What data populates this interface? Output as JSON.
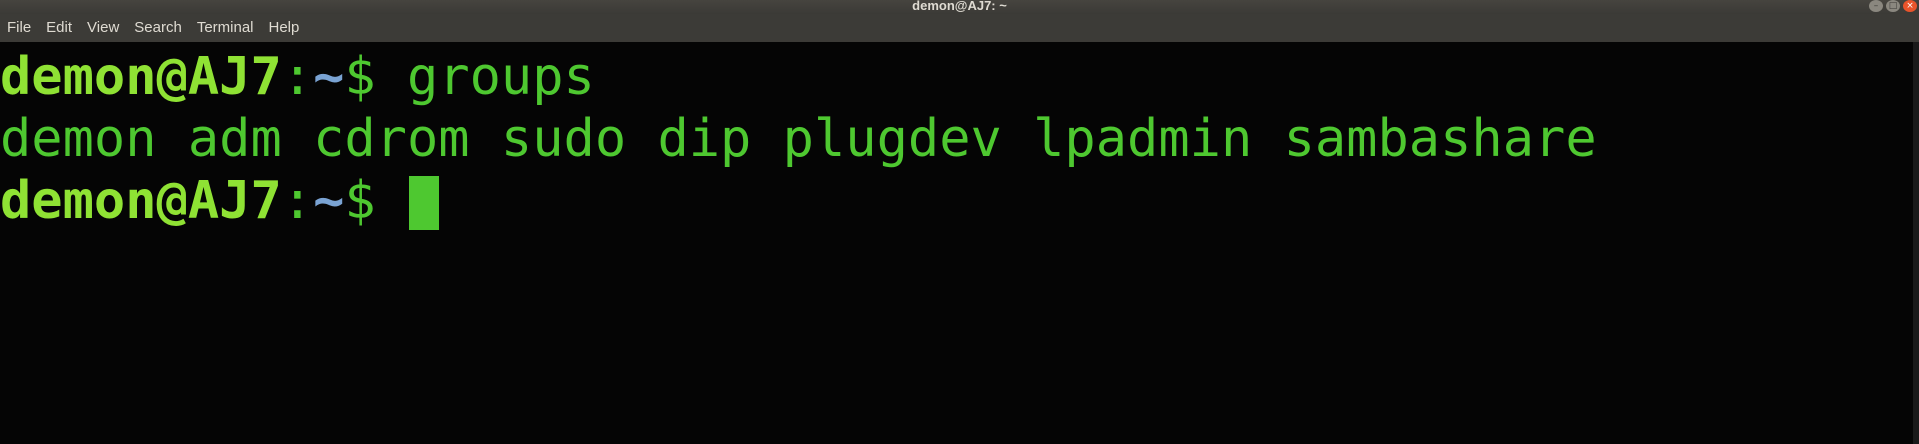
{
  "window": {
    "title": "demon@AJ7: ~",
    "controls": [
      "minimize",
      "maximize",
      "close"
    ]
  },
  "menu": {
    "items": [
      "File",
      "Edit",
      "View",
      "Search",
      "Terminal",
      "Help"
    ]
  },
  "terminal": {
    "prompt_user": "demon@AJ7",
    "prompt_colon": ":",
    "prompt_path": "~",
    "prompt_symbol": "$",
    "command": "groups",
    "output": "demon adm cdrom sudo dip plugdev lpadmin sambashare",
    "colors": {
      "background": "#050505",
      "text": "#4ec830",
      "user": "#8fe234",
      "path": "#7aa3d3"
    }
  }
}
